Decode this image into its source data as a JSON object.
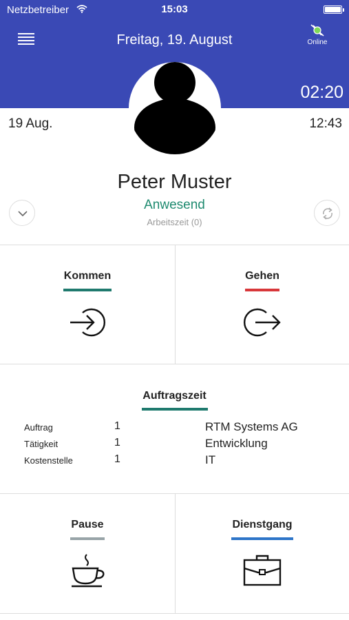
{
  "status_bar": {
    "carrier": "Netzbetreiber",
    "time": "15:03"
  },
  "header": {
    "date": "Freitag, 19. August",
    "online_label": "Online",
    "timer": "02:20",
    "background_color": "#3a49b5"
  },
  "profile": {
    "date_short": "19 Aug.",
    "time": "12:43",
    "name": "Peter Muster",
    "status": "Anwesend",
    "status_color": "#1e8a6f",
    "worktime": "Arbeitszeit (0)"
  },
  "actions": {
    "kommen": {
      "label": "Kommen",
      "color": "#1f7a6e",
      "icon": "login-arrow-icon"
    },
    "gehen": {
      "label": "Gehen",
      "color": "#d8373a",
      "icon": "logout-arrow-icon"
    },
    "pause": {
      "label": "Pause",
      "color": "#98a4a8",
      "icon": "coffee-cup-icon"
    },
    "dienstgang": {
      "label": "Dienstgang",
      "color": "#2e75c8",
      "icon": "briefcase-icon"
    }
  },
  "order": {
    "title": "Auftragszeit",
    "rows": [
      {
        "label": "Auftrag",
        "count": "1",
        "value": "RTM Systems AG"
      },
      {
        "label": "Tätigkeit",
        "count": "1",
        "value": "Entwicklung"
      },
      {
        "label": "Kostenstelle",
        "count": "1",
        "value": "IT"
      }
    ]
  }
}
